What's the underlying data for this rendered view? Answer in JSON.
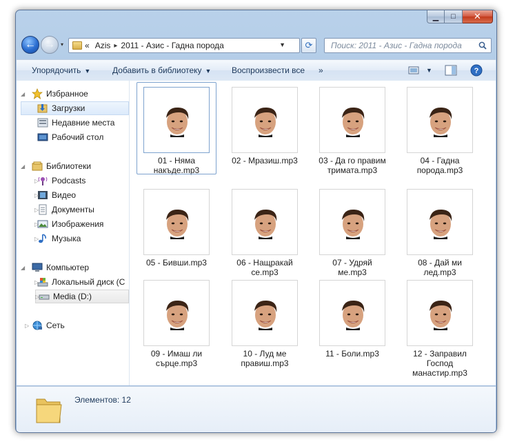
{
  "window": {
    "caption_buttons": {
      "minimize": "▁",
      "maximize": "□",
      "close": "✕"
    }
  },
  "nav": {
    "back_icon": "←",
    "forward_icon": "→",
    "history_icon": "▾",
    "address": {
      "overflow": "«",
      "crumbs": [
        "Azis",
        "2011 - Азис - Гадна порода"
      ],
      "separator": "▸"
    },
    "refresh_icon": "⟳",
    "search_placeholder": "Поиск: 2011 - Азис - Гадна порода"
  },
  "toolbar": {
    "organize": "Упорядочить",
    "add_to_library": "Добавить в библиотеку",
    "play_all": "Воспроизвести все",
    "more": "»",
    "caret": "▼"
  },
  "sidebar": {
    "favorites": {
      "label": "Избранное",
      "items": [
        "Загрузки",
        "Недавние места",
        "Рабочий стол"
      ]
    },
    "libraries": {
      "label": "Библиотеки",
      "items": [
        "Podcasts",
        "Видео",
        "Документы",
        "Изображения",
        "Музыка"
      ]
    },
    "computer": {
      "label": "Компьютер",
      "items": [
        "Локальный диск (C",
        "Media (D:)"
      ]
    },
    "network": {
      "label": "Сеть"
    }
  },
  "files": [
    "01 - Няма накъде.mp3",
    "02 - Мразиш.mp3",
    "03 - Да го правим тримата.mp3",
    "04 - Гадна порода.mp3",
    "05 - Бивши.mp3",
    "06 - Нащракай се.mp3",
    "07 - Удряй ме.mp3",
    "08 - Дай ми лед.mp3",
    "09 - Имаш ли сърце.mp3",
    "10 - Луд ме правиш.mp3",
    "11 - Боли.mp3",
    "12 - Заправил Господ манастир.mp3"
  ],
  "status": {
    "count_text": "Элементов: 12"
  },
  "colors": {
    "accent": "#2a6dd0",
    "frame": "#a6c2e2",
    "selection": "#dceafb"
  }
}
